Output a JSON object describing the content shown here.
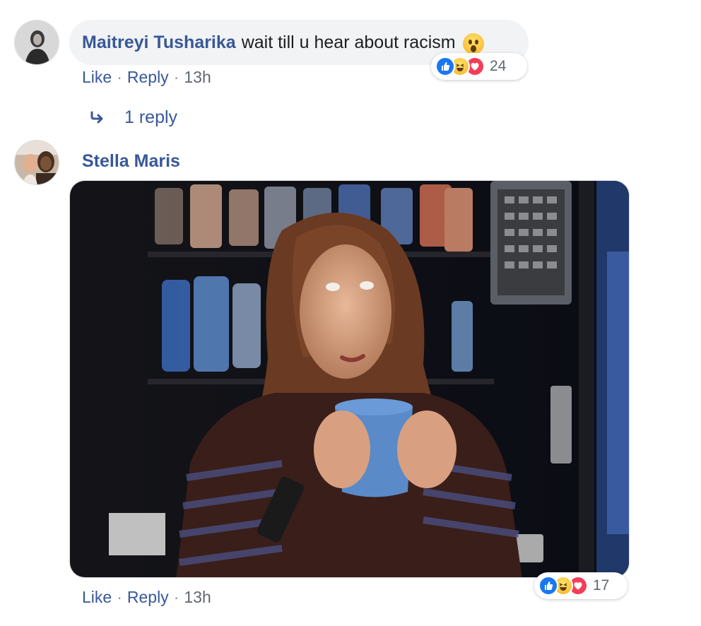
{
  "comments": [
    {
      "author": "Maitreyi Tusharika",
      "text": "wait till u hear about racism",
      "actions": {
        "like": "Like",
        "reply": "Reply",
        "time": "13h",
        "sep": "·"
      },
      "reactions": {
        "count": "24",
        "types": [
          "like-icon",
          "haha-icon",
          "love-icon"
        ]
      },
      "replies": "1 reply"
    },
    {
      "author": "Stella Maris",
      "attachment": "gif",
      "actions": {
        "like": "Like",
        "reply": "Reply",
        "time": "13h",
        "sep": "·"
      },
      "reactions": {
        "count": "17",
        "types": [
          "like-icon",
          "haha-icon",
          "love-icon"
        ]
      }
    }
  ],
  "colors": {
    "link": "#385898",
    "bubble": "#f2f3f5",
    "like": "#1877f2",
    "love": "#f33e58",
    "muted": "#606770"
  }
}
